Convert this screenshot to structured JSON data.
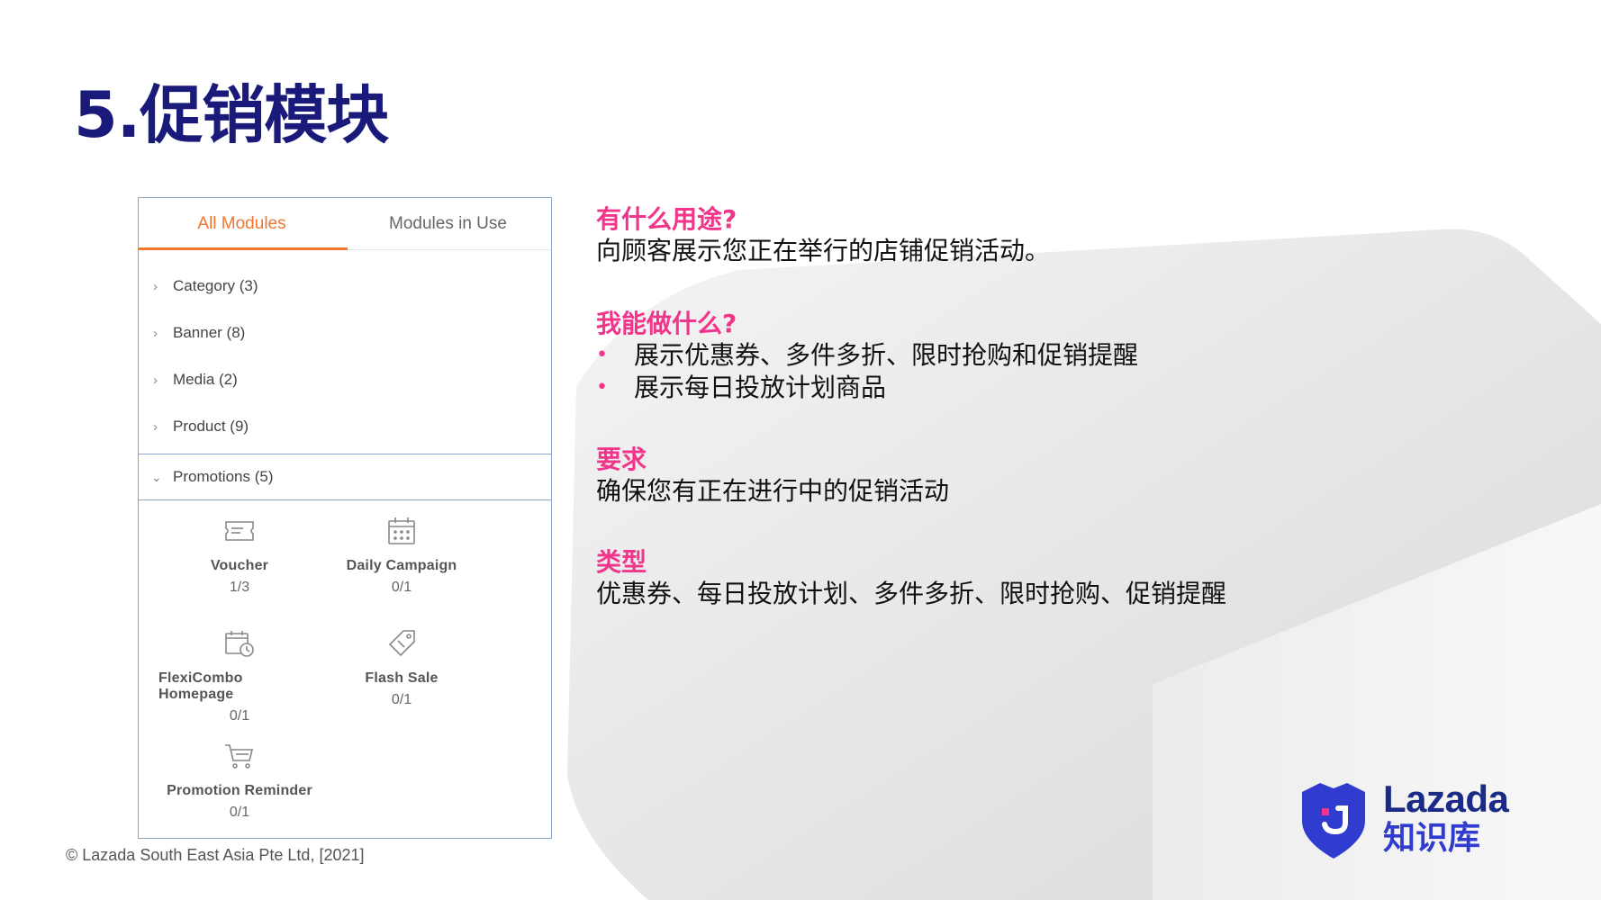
{
  "slide": {
    "title": "5.促销模块"
  },
  "panel": {
    "tabs": [
      {
        "label": "All Modules",
        "active": true
      },
      {
        "label": "Modules in Use",
        "active": false
      }
    ],
    "categories": [
      {
        "label": "Category (3)"
      },
      {
        "label": "Banner (8)"
      },
      {
        "label": "Media (2)"
      },
      {
        "label": "Product (9)"
      }
    ],
    "expanded_category": {
      "label": "Promotions (5)"
    },
    "modules": [
      {
        "name": "Voucher",
        "count": "1/3",
        "icon": "voucher-icon"
      },
      {
        "name": "Daily Campaign",
        "count": "0/1",
        "icon": "calendar-icon"
      },
      {
        "name": "FlexiCombo Homepage",
        "count": "0/1",
        "icon": "calendar-clock-icon"
      },
      {
        "name": "Flash Sale",
        "count": "0/1",
        "icon": "tag-icon"
      },
      {
        "name": "Promotion Reminder",
        "count": "0/1",
        "icon": "cart-icon"
      }
    ]
  },
  "info": {
    "purpose_heading": "有什么用途?",
    "purpose_text": "向顾客展示您正在举行的店铺促销活动。",
    "can_do_heading": "我能做什么?",
    "can_do_items": [
      "展示优惠券、多件多折、限时抢购和促销提醒",
      "展示每日投放计划商品"
    ],
    "req_heading": "要求",
    "req_text": "确保您有正在进行中的促销活动",
    "type_heading": "类型",
    "type_text": "优惠券、每日投放计划、多件多折、限时抢购、促销提醒"
  },
  "footer": {
    "copyright": "© Lazada South East Asia Pte Ltd, [2021]"
  },
  "logo": {
    "brand": "Lazada",
    "sub": "知识库"
  },
  "colors": {
    "title": "#1a1a7a",
    "accent_pink": "#f0358a",
    "tab_orange": "#f0762f",
    "panel_border": "#8aa6c8",
    "logo_blue": "#2f3ccf"
  }
}
